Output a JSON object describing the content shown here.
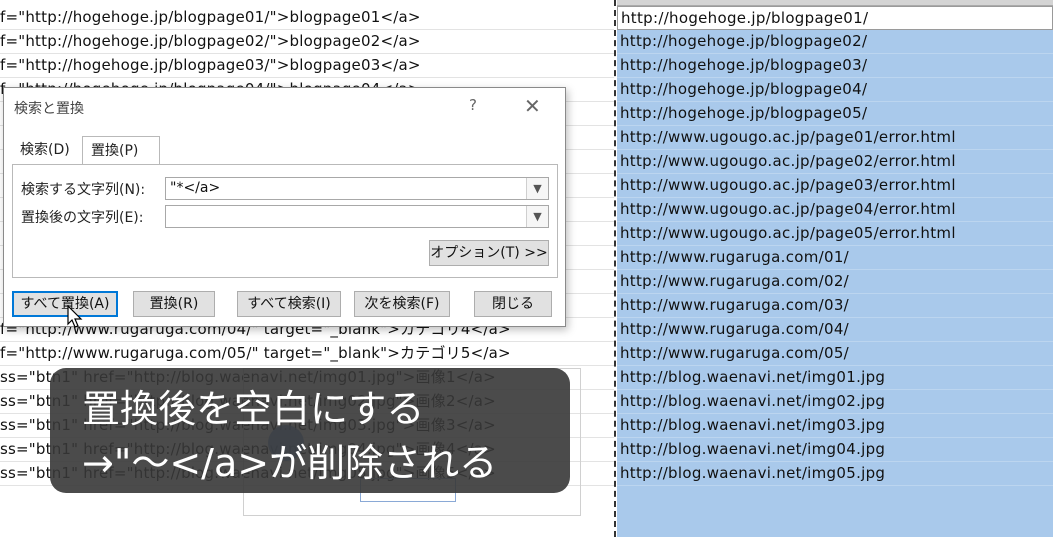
{
  "sheet": {
    "colA_rows": [
      "f=\"http://hogehoge.jp/blogpage01/\">blogpage01</a>",
      "f=\"http://hogehoge.jp/blogpage02/\">blogpage02</a>",
      "f=\"http://hogehoge.jp/blogpage03/\">blogpage03</a>",
      "f=\"http://hogehoge.jp/blogpage04/\">blogpage04</a>",
      "",
      "",
      "",
      "",
      "",
      "",
      "",
      "",
      "",
      "f=\"http://www.rugaruga.com/04/\" target=\"_blank\">カテゴリ4</a>",
      "f=\"http://www.rugaruga.com/05/\" target=\"_blank\">カテゴリ5</a>",
      "ss=\"btn1\" href=\"http://blog.waenavi.net/img01.jpg\">画像1</a>",
      "ss=\"btn1\" href=\"http://blog.waenavi.net/img02.jpg\">画像2</a>",
      "ss=\"btn1\" href=\"http://blog.waenavi.net/img03.jpg\">画像3</a>",
      "ss=\"btn1\" href=\"http://blog.waenavi.net/img04.jpg\">画像4</a>",
      "ss=\"btn1\" href=\"http://blog.waenavi.net/img05.jpg\">画像5</a>"
    ],
    "colB_rows": [
      "http://hogehoge.jp/blogpage01/",
      "http://hogehoge.jp/blogpage02/",
      "http://hogehoge.jp/blogpage03/",
      "http://hogehoge.jp/blogpage04/",
      "http://hogehoge.jp/blogpage05/",
      "http://www.ugougo.ac.jp/page01/error.html",
      "http://www.ugougo.ac.jp/page02/error.html",
      "http://www.ugougo.ac.jp/page03/error.html",
      "http://www.ugougo.ac.jp/page04/error.html",
      "http://www.ugougo.ac.jp/page05/error.html",
      "http://www.rugaruga.com/01/",
      "http://www.rugaruga.com/02/",
      "http://www.rugaruga.com/03/",
      "http://www.rugaruga.com/04/",
      "http://www.rugaruga.com/05/",
      "http://blog.waenavi.net/img01.jpg",
      "http://blog.waenavi.net/img02.jpg",
      "http://blog.waenavi.net/img03.jpg",
      "http://blog.waenavi.net/img04.jpg",
      "http://blog.waenavi.net/img05.jpg"
    ]
  },
  "dialog": {
    "title": "検索と置換",
    "help": "?",
    "close": "✕",
    "tabs": [
      "検索(D)",
      "置換(P)"
    ],
    "find_label": "検索する文字列(N):",
    "find_value": "\"*</a>",
    "replace_label": "置換後の文字列(E):",
    "replace_value": "",
    "options_button": "オプション(T) >>",
    "buttons": {
      "replace_all": "すべて置換(A)",
      "replace": "置換(R)",
      "find_all": "すべて検索(I)",
      "find_next": "次を検索(F)",
      "close": "閉じる"
    }
  },
  "caption": {
    "line1": "置換後を空白にする",
    "line2": "→\"～</a>が削除される"
  },
  "colors": {
    "selection": "#a9c9eb",
    "accent": "#0078d7",
    "caption_bg": "#373737"
  }
}
